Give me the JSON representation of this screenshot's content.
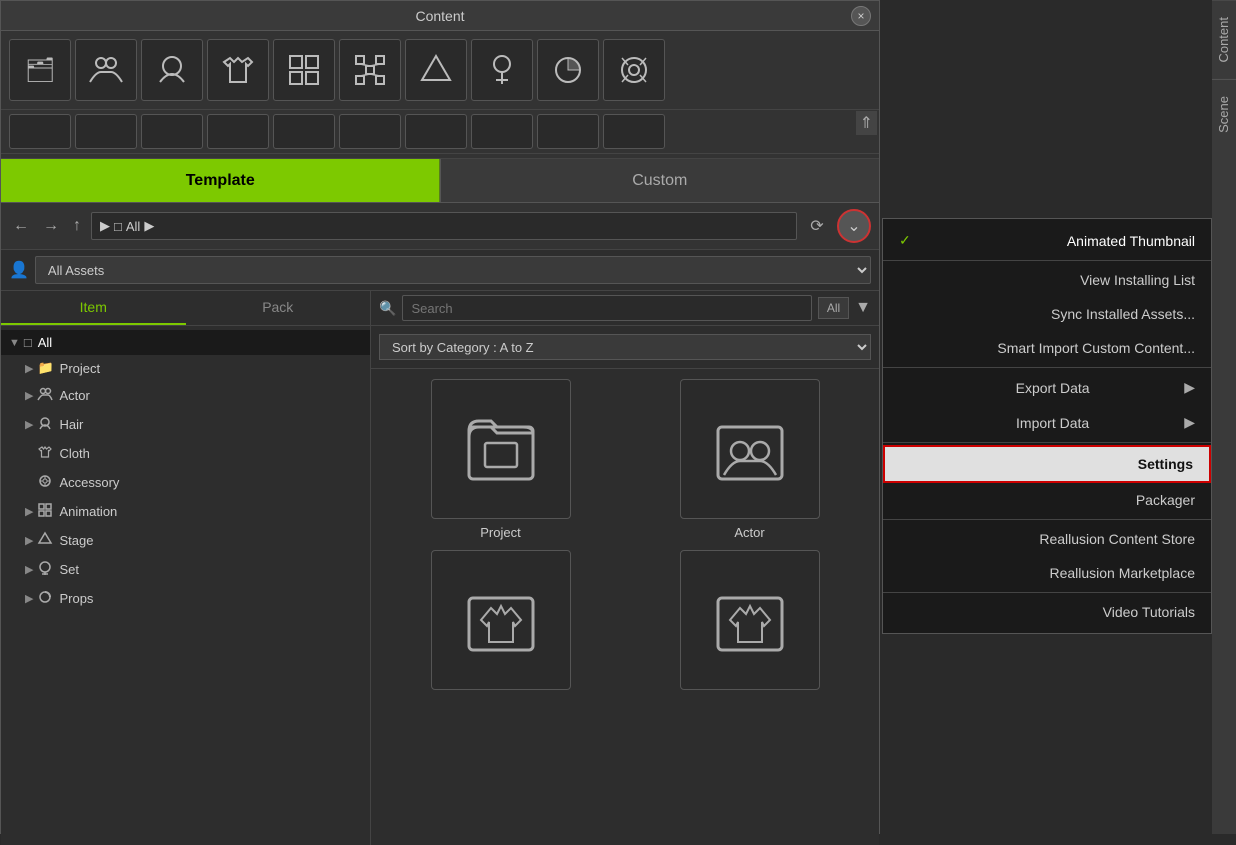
{
  "window": {
    "title": "Content",
    "close_label": "×"
  },
  "toolbar": {
    "icons": [
      {
        "name": "folder-icon",
        "symbol": "🗂"
      },
      {
        "name": "actors-icon",
        "symbol": "👥"
      },
      {
        "name": "head-icon",
        "symbol": "👤"
      },
      {
        "name": "shirt-icon",
        "symbol": "👕"
      },
      {
        "name": "table-icon",
        "symbol": "⊞"
      },
      {
        "name": "network-icon",
        "symbol": "⊠"
      },
      {
        "name": "landscape-icon",
        "symbol": "△"
      },
      {
        "name": "tree-icon",
        "symbol": "🌳"
      },
      {
        "name": "pie-chart-icon",
        "symbol": "◑"
      },
      {
        "name": "film-icon",
        "symbol": "🎬"
      }
    ]
  },
  "collapse_arrows": "⇑",
  "tabs": {
    "template_label": "Template",
    "custom_label": "Custom"
  },
  "nav": {
    "back_label": "←",
    "forward_label": "→",
    "up_label": "↑",
    "path_prefix": "▶",
    "path_icon": "□",
    "path_label": "All",
    "path_suffix": "▶",
    "refresh_label": "⟳",
    "dropdown_label": "⌄"
  },
  "asset_filter": {
    "user_icon": "👤",
    "label": "All Assets",
    "dropdown_arrow": "▼"
  },
  "item_pack_tabs": {
    "item_label": "Item",
    "pack_label": "Pack"
  },
  "search": {
    "placeholder": "Search",
    "all_label": "All",
    "filter_icon": "▼"
  },
  "sort": {
    "label": "Sort by Category : A to Z",
    "arrow": "▼"
  },
  "tree": {
    "items": [
      {
        "label": "All",
        "icon": "□",
        "arrow": "▼",
        "selected": true,
        "indent": 0
      },
      {
        "label": "Project",
        "icon": "📁",
        "arrow": "▶",
        "selected": false,
        "indent": 1
      },
      {
        "label": "Actor",
        "icon": "👥",
        "arrow": "▶",
        "selected": false,
        "indent": 1
      },
      {
        "label": "Hair",
        "icon": "👤",
        "arrow": "▶",
        "selected": false,
        "indent": 1
      },
      {
        "label": "Cloth",
        "icon": "👕",
        "arrow": "",
        "selected": false,
        "indent": 1
      },
      {
        "label": "Accessory",
        "icon": "🔮",
        "arrow": "",
        "selected": false,
        "indent": 1
      },
      {
        "label": "Animation",
        "icon": "⊠",
        "arrow": "▶",
        "selected": false,
        "indent": 1
      },
      {
        "label": "Stage",
        "icon": "△",
        "arrow": "▶",
        "selected": false,
        "indent": 1
      },
      {
        "label": "Set",
        "icon": "🌳",
        "arrow": "▶",
        "selected": false,
        "indent": 1
      },
      {
        "label": "Props",
        "icon": "◑",
        "arrow": "▶",
        "selected": false,
        "indent": 1
      }
    ]
  },
  "grid": {
    "items": [
      {
        "label": "Project",
        "icon": "🗂"
      },
      {
        "label": "Actor",
        "icon": "👥"
      },
      {
        "label": "",
        "icon": "👕"
      },
      {
        "label": "",
        "icon": "👕"
      }
    ]
  },
  "side_tabs": [
    {
      "label": "Content"
    },
    {
      "label": "Scene"
    }
  ],
  "dropdown_menu": {
    "items": [
      {
        "label": "Animated Thumbnail",
        "checked": true,
        "arrow": false,
        "highlighted": false,
        "separator_after": false
      },
      {
        "label": "View Installing List",
        "checked": false,
        "arrow": false,
        "highlighted": false,
        "separator_after": false
      },
      {
        "label": "Sync Installed Assets...",
        "checked": false,
        "arrow": false,
        "highlighted": false,
        "separator_after": false
      },
      {
        "label": "Smart Import Custom Content...",
        "checked": false,
        "arrow": false,
        "highlighted": false,
        "separator_after": true
      },
      {
        "label": "Export Data",
        "checked": false,
        "arrow": true,
        "highlighted": false,
        "separator_after": false
      },
      {
        "label": "Import Data",
        "checked": false,
        "arrow": true,
        "highlighted": false,
        "separator_after": true
      },
      {
        "label": "Settings",
        "checked": false,
        "arrow": false,
        "highlighted": true,
        "separator_after": false
      },
      {
        "label": "Packager",
        "checked": false,
        "arrow": false,
        "highlighted": false,
        "separator_after": true
      },
      {
        "label": "Reallusion Content Store",
        "checked": false,
        "arrow": false,
        "highlighted": false,
        "separator_after": false
      },
      {
        "label": "Reallusion Marketplace",
        "checked": false,
        "arrow": false,
        "highlighted": false,
        "separator_after": true
      },
      {
        "label": "Video Tutorials",
        "checked": false,
        "arrow": false,
        "highlighted": false,
        "separator_after": false
      }
    ]
  }
}
